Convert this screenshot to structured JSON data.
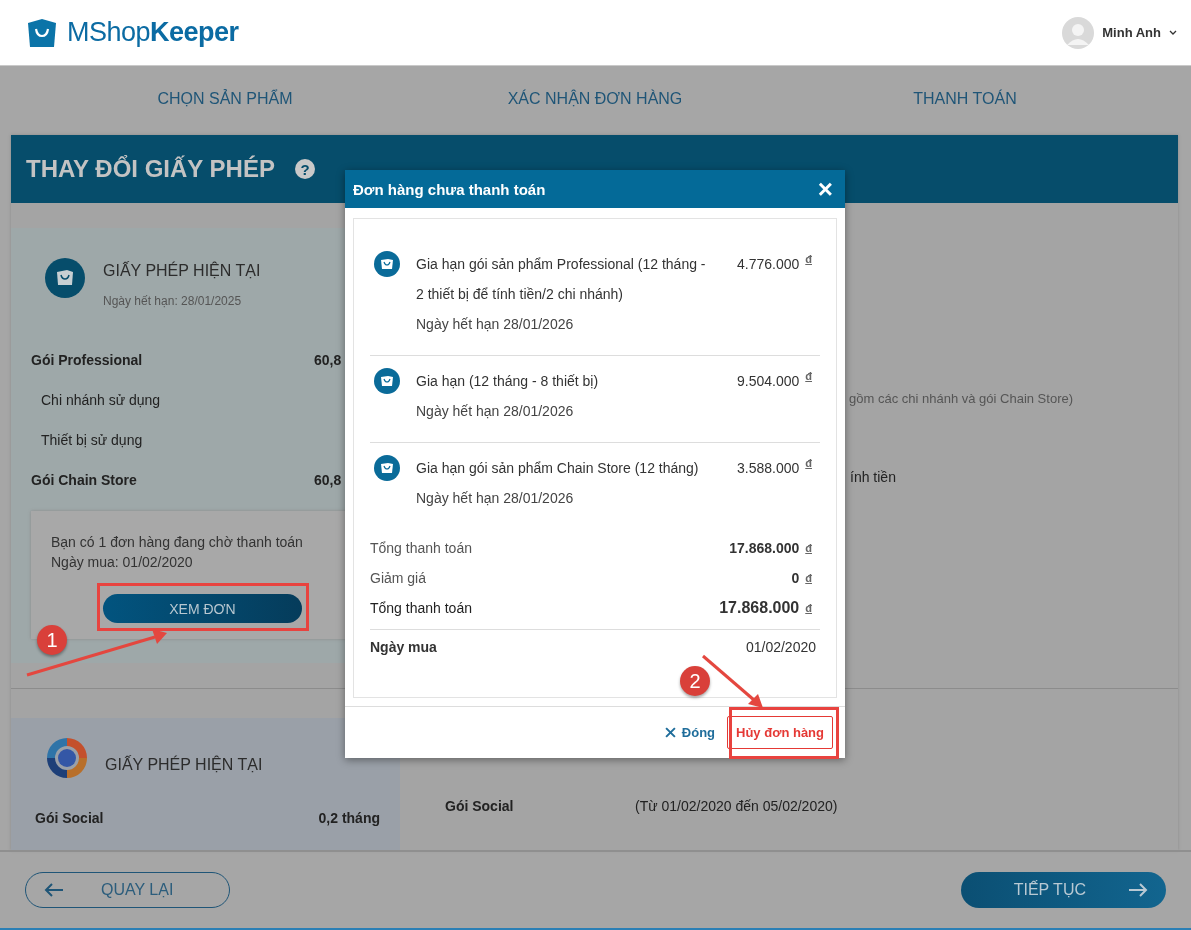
{
  "header": {
    "logo": "MShop**Keeper**",
    "user": "Minh Anh"
  },
  "steps": [
    {
      "label": "CHỌN SẢN PHẨM"
    },
    {
      "label": "XÁC NHẬN ĐƠN HÀNG"
    },
    {
      "label": "THANH TOÁN"
    }
  ],
  "page": {
    "title": "THAY ĐỔI GIẤY PHÉP",
    "help": "?"
  },
  "current_license": {
    "title": "GIẤY PHÉP HIỆN TẠI",
    "expiry": "Ngày hết hạn: 28/01/2025",
    "rows": [
      {
        "kind": "main",
        "label": "Gói Professional",
        "value": "60,8"
      },
      {
        "kind": "sub",
        "label": "Chi nhánh sử dụng"
      },
      {
        "kind": "sub",
        "label": "Thiết bị sử dụng"
      },
      {
        "kind": "main",
        "label": "Gói Chain Store",
        "value": "60,8"
      }
    ],
    "pending": {
      "message": "Bạn có 1 đơn hàng đang chờ thanh toán",
      "date": "Ngày mua: 01/02/2020",
      "button": "XEM ĐƠN"
    }
  },
  "right_notes": {
    "branches": "gồm các chi nhánh và gói Chain Store)",
    "devices": "ính tiền"
  },
  "social_license": {
    "title": "GIẤY PHÉP HIỆN TẠI",
    "rows": [
      {
        "label": "Gói Social",
        "value": "0,2 tháng"
      }
    ],
    "detail": {
      "label": "Gói Social",
      "period": "(Từ 01/02/2020 đến 05/02/2020)"
    }
  },
  "modal": {
    "title": "Đơn hàng chưa thanh toán",
    "close": "×",
    "items": [
      {
        "title": "Gia hạn gói sản phẩm Professional (12 tháng - 2 thiết bị để tính tiền/2 chi nhánh)",
        "price": "4.776.000",
        "currency": "đ",
        "expiry": "Ngày hết hạn 28/01/2026"
      },
      {
        "title": "Gia hạn (12 tháng - 8 thiết bị)",
        "price": "9.504.000",
        "currency": "đ",
        "expiry": "Ngày hết hạn 28/01/2026"
      },
      {
        "title": "Gia hạn gói sản phẩm Chain Store (12 tháng)",
        "price": "3.588.000",
        "currency": "đ",
        "expiry": "Ngày hết hạn 28/01/2026"
      }
    ],
    "summary": [
      {
        "kind": "normal",
        "label": "Tổng thanh toán",
        "value": "17.868.000",
        "currency": "đ"
      },
      {
        "kind": "normal",
        "label": "Giảm giá",
        "value": "0",
        "currency": "đ"
      },
      {
        "kind": "total",
        "label": "Tổng thanh toán",
        "value": "17.868.000",
        "currency": "đ"
      }
    ],
    "purchase_date": {
      "label": "Ngày mua",
      "value": "01/02/2020"
    },
    "close_button": "Đóng",
    "cancel_button": "Hủy đơn hàng"
  },
  "footer": {
    "back": "QUAY LẠI",
    "next": "TIẾP TỤC"
  },
  "annotations": [
    {
      "number": "1"
    },
    {
      "number": "2"
    }
  ]
}
